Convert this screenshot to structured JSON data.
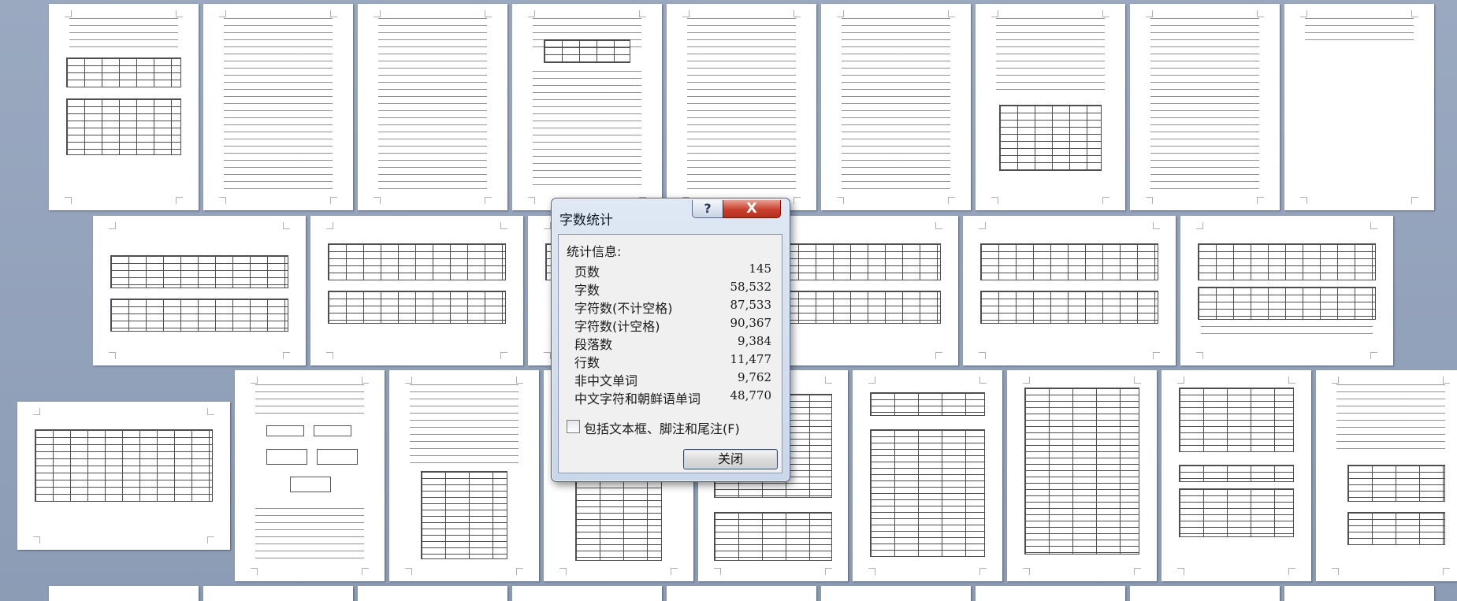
{
  "dialog": {
    "title": "字数统计",
    "help_label": "?",
    "close_x_label": "X",
    "stats_heading": "统计信息:",
    "stats": [
      {
        "label": "页数",
        "value": "145"
      },
      {
        "label": "字数",
        "value": "58,532"
      },
      {
        "label": "字符数(不计空格)",
        "value": "87,533"
      },
      {
        "label": "字符数(计空格)",
        "value": "90,367"
      },
      {
        "label": "段落数",
        "value": "9,384"
      },
      {
        "label": "行数",
        "value": "11,477"
      },
      {
        "label": "非中文单词",
        "value": "9,762"
      },
      {
        "label": "中文字符和朝鲜语单词",
        "value": "48,770"
      }
    ],
    "include_label": "包括文本框、脚注和尾注(F)",
    "include_checked": false,
    "close_button_label": "关闭"
  }
}
